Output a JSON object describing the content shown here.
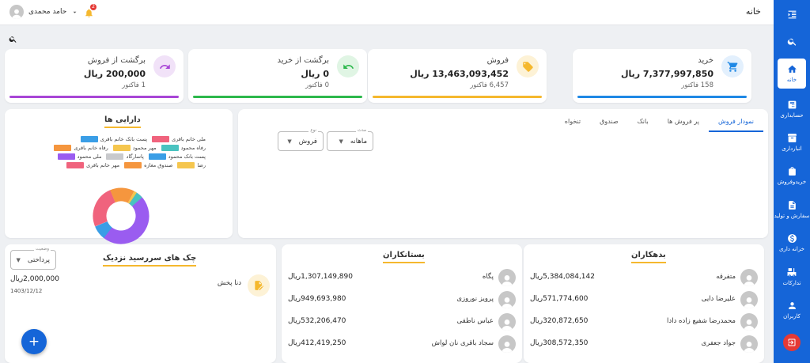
{
  "header": {
    "title": "خانه",
    "user_name": "حامد محمدی",
    "notification_count": "2"
  },
  "sidebar": {
    "items": [
      {
        "label": "خانه",
        "icon": "home-icon"
      },
      {
        "label": "حسابداری",
        "icon": "calculator-icon"
      },
      {
        "label": "انبارداری",
        "icon": "archive-icon"
      },
      {
        "label": "خریدوفروش",
        "icon": "shopping-bag-icon"
      },
      {
        "label": "سفارش و تولید",
        "icon": "document-icon"
      },
      {
        "label": "خزانه داری",
        "icon": "dollar-icon"
      },
      {
        "label": "تدارکات",
        "icon": "forklift-icon"
      },
      {
        "label": "کاربران",
        "icon": "person-icon"
      }
    ]
  },
  "stats": [
    {
      "title": "خرید",
      "amount": "7,377,997,850 ریال",
      "count": "158 فاکتور",
      "color": "#1e88e5",
      "bg": "#e3f0fd",
      "icon": "cart-icon"
    },
    {
      "title": "فروش",
      "amount": "13,463,093,452 ریال",
      "count": "6,457 فاکتور",
      "color": "#f5b82e",
      "bg": "#fdf2d6",
      "icon": "tag-icon"
    },
    {
      "title": "برگشت از خرید",
      "amount": "0 ریال",
      "count": "0 فاکتور",
      "color": "#2db84c",
      "bg": "#e0f5e4",
      "icon": "return-icon"
    },
    {
      "title": "برگشت از فروش",
      "amount": "200,000 ریال",
      "count": "1 فاکتور",
      "color": "#a845d6",
      "bg": "#f1e2f8",
      "icon": "redo-icon"
    }
  ],
  "assets": {
    "title": "دارایی ها",
    "legend": [
      {
        "label": "ملی خانم باقری",
        "color": "#f0637d"
      },
      {
        "label": "پست بانک خانم باقری",
        "color": "#3a9ee6"
      },
      {
        "label": "رفاه محمود",
        "color": "#49c3c0"
      },
      {
        "label": "مهر محمود",
        "color": "#f5c64e"
      },
      {
        "label": "رفاه خانم باقری",
        "color": "#f5963e"
      },
      {
        "label": "پست بانک محمود",
        "color": "#3a9ee6"
      },
      {
        "label": "پاسارگاد",
        "color": "#c8c9cc"
      },
      {
        "label": "ملی محمود",
        "color": "#9a5cf0"
      },
      {
        "label": "رضا",
        "color": "#f5c64e"
      },
      {
        "label": "صندوق مغازه",
        "color": "#f5963e"
      },
      {
        "label": "مهر خانم باقری",
        "color": "#f0637d"
      }
    ]
  },
  "sales": {
    "tabs": [
      "نمودار فروش",
      "پر فروش ها",
      "بانک",
      "صندوق",
      "تنخواه"
    ],
    "period_label": "مدت",
    "period_value": "ماهانه",
    "type_label": "نوع",
    "type_value": "فروش"
  },
  "debtors": {
    "title": "بدهکاران",
    "rows": [
      {
        "name": "متفرقه",
        "value": "5,384,084,142ریال"
      },
      {
        "name": "علیرضا دایی",
        "value": "571,774,600ریال"
      },
      {
        "name": "محمدرضا شفیع زاده دادا",
        "value": "320,872,650ریال"
      },
      {
        "name": "جواد جعفری",
        "value": "308,572,350ریال"
      }
    ]
  },
  "creditors": {
    "title": "بستانکاران",
    "rows": [
      {
        "name": "پگاه",
        "value": "1,307,149,890ریال"
      },
      {
        "name": "پرویز نوروزی",
        "value": "949,693,980ریال"
      },
      {
        "name": "عباس ناطقی",
        "value": "532,206,470ریال"
      },
      {
        "name": "سجاد باقری نان لواش",
        "value": "412,419,250ریال"
      }
    ]
  },
  "checks": {
    "title": "چک های سررسید نزدیک",
    "status_label": "وضعیت",
    "status_value": "پرداختی",
    "items": [
      {
        "name": "دنا پخش",
        "amount": "2,000,000ریال",
        "date": "1403/12/12"
      }
    ]
  }
}
